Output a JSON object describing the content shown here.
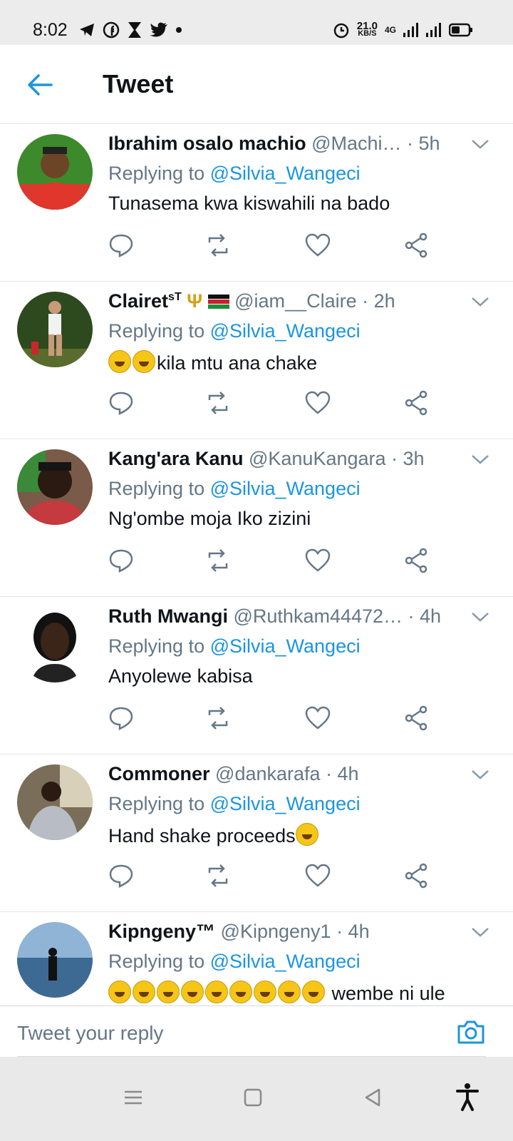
{
  "status_bar": {
    "time": "8:02",
    "net_speed_value": "21.0",
    "net_speed_unit": "KB/S",
    "network": "4G",
    "icons": [
      "telegram-icon",
      "facebook-icon",
      "hourglass-icon",
      "twitter-icon",
      "dot-icon",
      "alarm-icon",
      "signal-icon",
      "battery-icon"
    ]
  },
  "header": {
    "title": "Tweet"
  },
  "tweets": [
    {
      "name": "Ibrahim osalo machio",
      "handle": "@Machi…",
      "time": "· 5h",
      "reply_prefix": "Replying to ",
      "reply_to": "@Silvia_Wangeci",
      "text": "Tunasema kwa kiswahili na bado"
    },
    {
      "name": "Clairet",
      "name_sup": "sT",
      "handle": "@iam__Claire",
      "time": "· 2h",
      "reply_prefix": "Replying to ",
      "reply_to": "@Silvia_Wangeci",
      "text": "kila mtu ana chake"
    },
    {
      "name": "Kang'ara Kanu",
      "handle": "@KanuKangara",
      "time": "· 3h",
      "reply_prefix": "Replying to ",
      "reply_to": "@Silvia_Wangeci",
      "text": "Ng'ombe moja Iko zizini"
    },
    {
      "name": "Ruth Mwangi",
      "handle": "@Ruthkam44472…",
      "time": "· 4h",
      "reply_prefix": "Replying to ",
      "reply_to": "@Silvia_Wangeci",
      "text": "Anyolewe kabisa"
    },
    {
      "name": "Commoner",
      "handle": "@dankarafa",
      "time": "· 4h",
      "reply_prefix": "Replying to ",
      "reply_to": "@Silvia_Wangeci",
      "text": "Hand shake proceeds"
    },
    {
      "name": "Kipngeny™",
      "handle": "@Kipngeny1",
      "time": "· 4h",
      "reply_prefix": "Replying to ",
      "reply_to": "@Silvia_Wangeci",
      "text": "wembe ni ule"
    }
  ],
  "reply_bar": {
    "placeholder": "Tweet your reply"
  },
  "colors": {
    "accent": "#1b95e0",
    "muted": "#657786",
    "text": "#0f1419"
  }
}
